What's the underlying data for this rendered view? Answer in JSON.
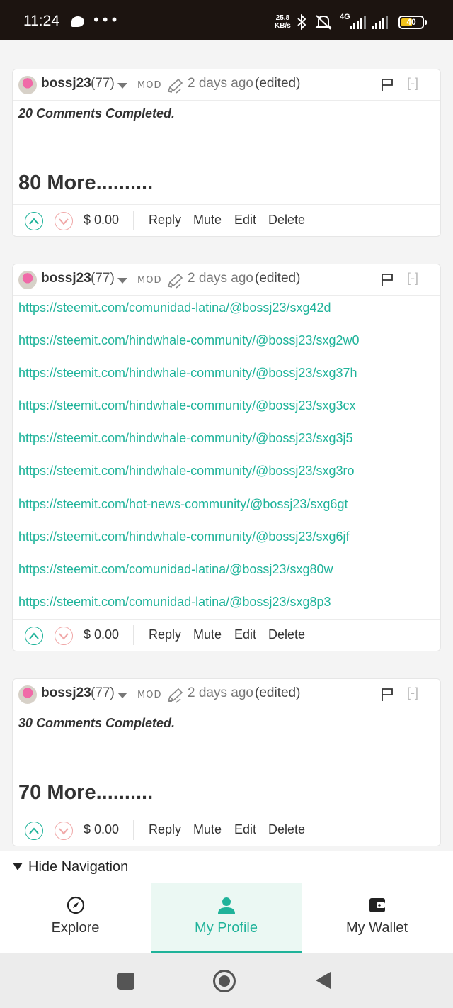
{
  "status_bar": {
    "time": "11:24",
    "dots": "•••",
    "speed_value": "25.8",
    "speed_unit": "KB/s",
    "network": "4G",
    "battery": "40",
    "battery_color": "#f3c31a"
  },
  "comments": [
    {
      "author": "bossj23",
      "reputation": "(77)",
      "role": "MOD",
      "time_ago": "2 days ago",
      "edited": "(edited)",
      "collapse": "[-]",
      "body_lines": [
        "20 Comments Completed."
      ],
      "big_line": "80 More..........",
      "payout": "$ 0.00",
      "actions": [
        "Reply",
        "Mute",
        "Edit",
        "Delete"
      ]
    },
    {
      "author": "bossj23",
      "reputation": "(77)",
      "role": "MOD",
      "time_ago": "2 days ago",
      "edited": "(edited)",
      "collapse": "[-]",
      "links": [
        "https://steemit.com/comunidad-latina/@bossj23/sxg42d",
        "https://steemit.com/hindwhale-community/@bossj23/sxg2w0",
        "https://steemit.com/hindwhale-community/@bossj23/sxg37h",
        "https://steemit.com/hindwhale-community/@bossj23/sxg3cx",
        "https://steemit.com/hindwhale-community/@bossj23/sxg3j5",
        "https://steemit.com/hindwhale-community/@bossj23/sxg3ro",
        "https://steemit.com/hot-news-community/@bossj23/sxg6gt",
        "https://steemit.com/hindwhale-community/@bossj23/sxg6jf",
        "https://steemit.com/comunidad-latina/@bossj23/sxg80w",
        "https://steemit.com/comunidad-latina/@bossj23/sxg8p3"
      ],
      "payout": "$ 0.00",
      "actions": [
        "Reply",
        "Mute",
        "Edit",
        "Delete"
      ]
    },
    {
      "author": "bossj23",
      "reputation": "(77)",
      "role": "MOD",
      "time_ago": "2 days ago",
      "edited": "(edited)",
      "collapse": "[-]",
      "body_lines": [
        "30 Comments Completed."
      ],
      "big_line": "70 More..........",
      "payout": "$ 0.00",
      "actions": [
        "Reply",
        "Mute",
        "Edit",
        "Delete"
      ]
    }
  ],
  "hide_navigation": "Hide Navigation",
  "tabs": [
    {
      "label": "Explore",
      "icon": "compass-icon",
      "active": false
    },
    {
      "label": "My Profile",
      "icon": "user-icon",
      "active": true
    },
    {
      "label": "My Wallet",
      "icon": "wallet-icon",
      "active": false
    }
  ],
  "colors": {
    "accent": "#1fb39a",
    "downvote": "#f0a7a7",
    "status_bar": "#1c1410"
  }
}
